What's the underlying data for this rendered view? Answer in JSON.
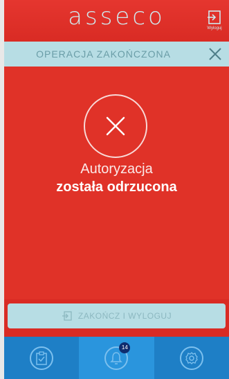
{
  "header": {
    "logo": "asseco",
    "logout_label": "Wyloguj"
  },
  "status": {
    "text": "OPERACJA ZAKOŃCZONA"
  },
  "message": {
    "line1": "Autoryzacja",
    "line2": "została odrzucona"
  },
  "finish_button": {
    "label": "ZAKOŃCZ I WYLOGUJ"
  },
  "tabbar": {
    "badge_count": "14",
    "tabs": [
      {
        "icon": "clipboard-check-icon"
      },
      {
        "icon": "bell-icon"
      },
      {
        "icon": "settings-gear-icon"
      }
    ]
  },
  "colors": {
    "primary_red": "#d92b24",
    "accent_teal": "#b7dde4",
    "nav_blue": "#1e7fc6"
  }
}
